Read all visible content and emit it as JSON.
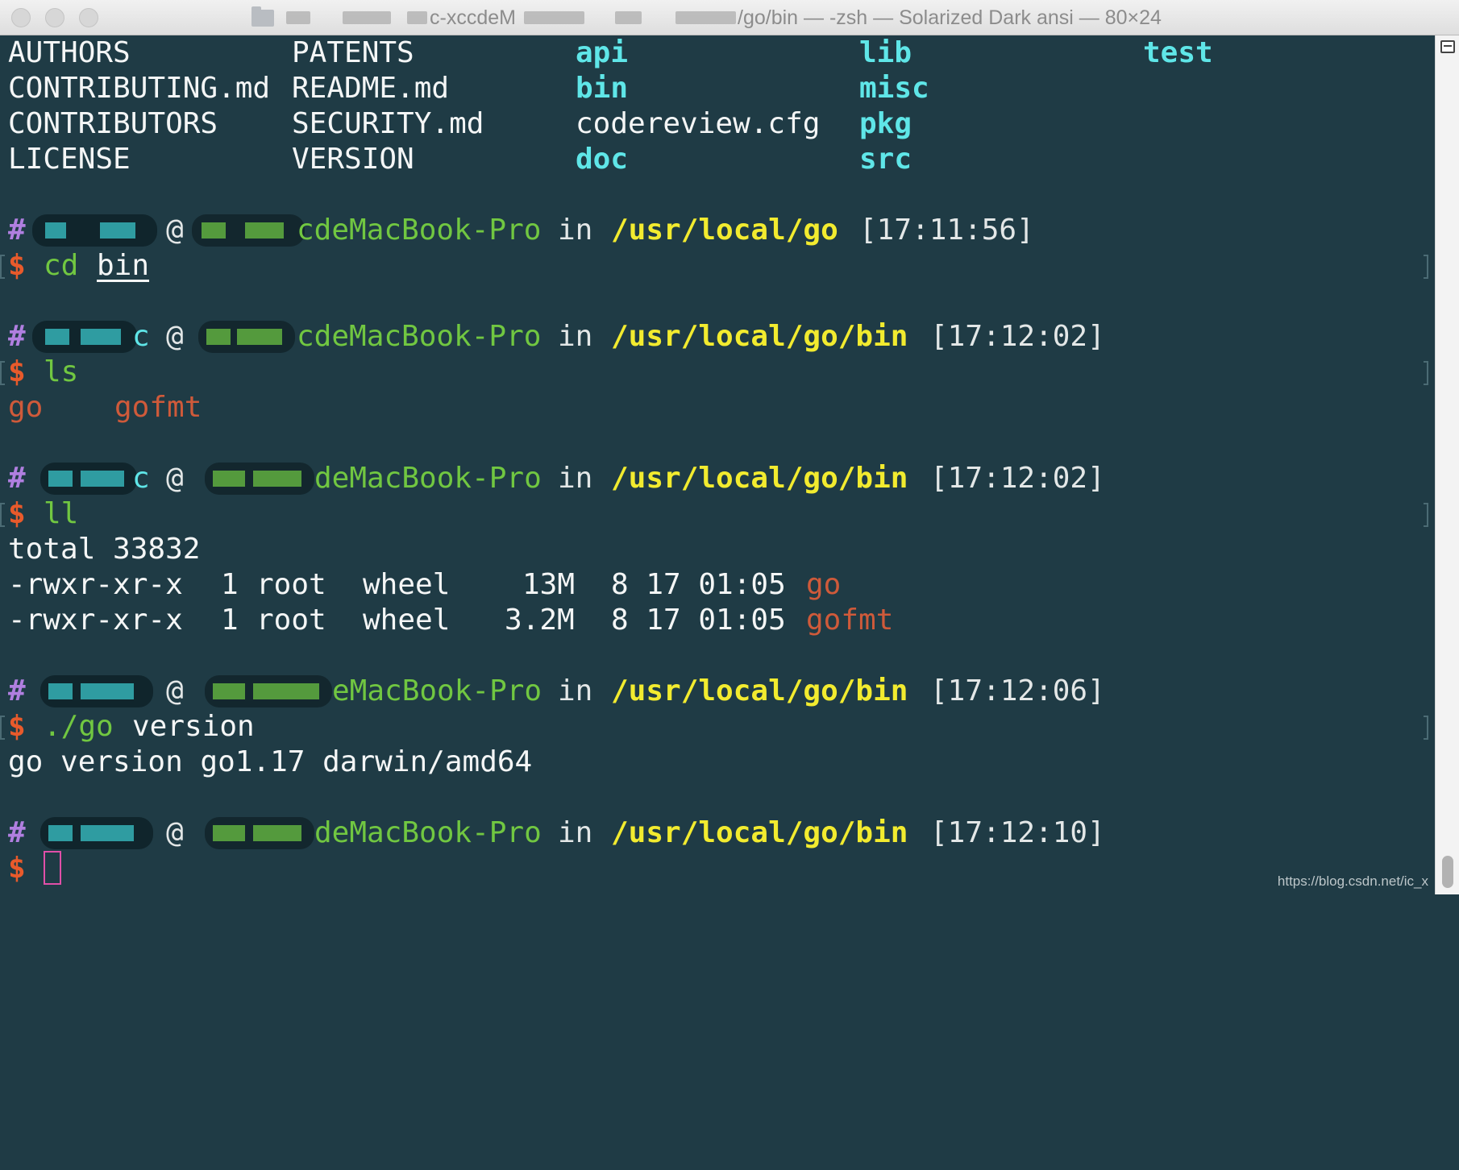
{
  "window": {
    "title_fragment_1": "c-xccdeM",
    "title_fragment_2": "/go/bin — -zsh — Solarized Dark ansi — 80×24"
  },
  "listing": {
    "col1": [
      "AUTHORS",
      "CONTRIBUTING.md",
      "CONTRIBUTORS",
      "LICENSE"
    ],
    "col2": [
      "PATENTS",
      "README.md",
      "SECURITY.md",
      "VERSION"
    ],
    "col3": [
      "api",
      "bin",
      "codereview.cfg",
      "doc"
    ],
    "col4": [
      "lib",
      "misc",
      "pkg",
      "src"
    ],
    "col5": [
      "test"
    ]
  },
  "prompts": [
    {
      "hash": "#",
      "at": "@",
      "host_tail": "cdeMacBook-Pro",
      "in": "in",
      "path": "/usr/local/go",
      "time": "[17:11:56]",
      "dollar": "$",
      "cmd_a": "cd",
      "cmd_b": "bin"
    },
    {
      "hash": "#",
      "user_tail": "c",
      "at": "@",
      "host_tail": "cdeMacBook-Pro",
      "in": "in",
      "path": "/usr/local/go/bin",
      "time": "[17:12:02]",
      "dollar": "$",
      "cmd_a": "ls"
    },
    {
      "hash": "#",
      "user_tail": "c",
      "at": "@",
      "host_tail": "deMacBook-Pro",
      "in": "in",
      "path": "/usr/local/go/bin",
      "time": "[17:12:02]",
      "dollar": "$",
      "cmd_a": "ll"
    },
    {
      "hash": "#",
      "at": "@",
      "host_tail": "eMacBook-Pro",
      "in": "in",
      "path": "/usr/local/go/bin",
      "time": "[17:12:06]",
      "dollar": "$",
      "cmd_a": "./go",
      "cmd_b": "version"
    },
    {
      "hash": "#",
      "at": "@",
      "host_tail": "deMacBook-Pro",
      "in": "in",
      "path": "/usr/local/go/bin",
      "time": "[17:12:10]",
      "dollar": "$"
    }
  ],
  "ls_output": [
    "go",
    "gofmt"
  ],
  "ll_output": {
    "total": "total 33832",
    "rows": [
      {
        "perms": "-rwxr-xr-x",
        "links": "1",
        "owner": "root",
        "group": "wheel",
        "size": "13M",
        "date": "8 17 01:05",
        "name": "go"
      },
      {
        "perms": "-rwxr-xr-x",
        "links": "1",
        "owner": "root",
        "group": "wheel",
        "size": "3.2M",
        "date": "8 17 01:05",
        "name": "gofmt"
      }
    ]
  },
  "version_output": "go version go1.17 darwin/amd64",
  "watermark": "https://blog.csdn.net/ic_x",
  "colors": {
    "background": "#1f3b45",
    "directory": "#5fe6e8",
    "path": "#f2eb2f",
    "host": "#71c741",
    "executable": "#cf5a3a",
    "cursor": "#e04fa8"
  }
}
